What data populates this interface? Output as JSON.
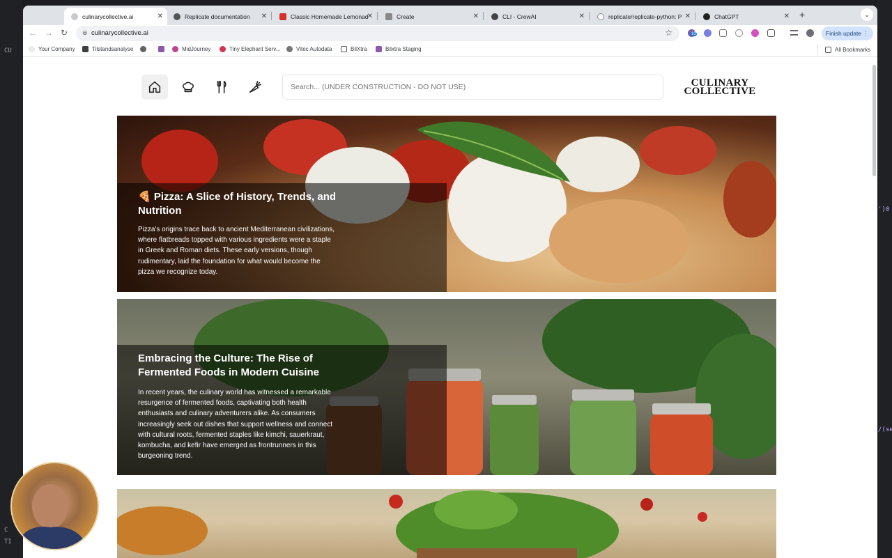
{
  "browser": {
    "tabs": [
      {
        "title": "culinarycollective.ai",
        "active": true
      },
      {
        "title": "Replicate documentation",
        "active": false
      },
      {
        "title": "Classic Homemade Lemonad",
        "active": false
      },
      {
        "title": "Create",
        "active": false
      },
      {
        "title": "CLI - CrewAI",
        "active": false
      },
      {
        "title": "replicate/replicate-python: P",
        "active": false
      },
      {
        "title": "ChatGPT",
        "active": false
      }
    ],
    "new_tab_symbol": "+",
    "url": "culinarycollective.ai",
    "finish_update_label": "Finish update",
    "extension_badge": "10",
    "bookmarks": [
      {
        "label": "Your Company",
        "icon": "globe-icon"
      },
      {
        "label": "Tilstandsanalyse",
        "icon": "page-icon"
      },
      {
        "label": "",
        "icon": "globe-icon"
      },
      {
        "label": "",
        "icon": "flag-icon"
      },
      {
        "label": "MidJourney",
        "icon": "midjourney-icon"
      },
      {
        "label": "Tiny Elephant Serv...",
        "icon": "elephant-icon"
      },
      {
        "label": "Vitec Autodata",
        "icon": "vitec-icon"
      },
      {
        "label": "BilXtra",
        "icon": "folder-icon"
      },
      {
        "label": "Bilxtra Staging",
        "icon": "flag-icon"
      }
    ],
    "all_bookmarks_label": "All Bookmarks"
  },
  "site": {
    "logo_line1": "CULINARY",
    "logo_line2": "COLLECTIVE",
    "search_placeholder": "Search... (UNDER CONSTRUCTION - DO NOT USE)",
    "nav": [
      "home-icon",
      "chef-hat-icon",
      "cutlery-icon",
      "carrot-icon"
    ]
  },
  "articles": [
    {
      "emoji": "🍕",
      "title": "Pizza: A Slice of History, Trends, and Nutrition",
      "excerpt": "Pizza's origins trace back to ancient Mediterranean civilizations, where flatbreads topped with various ingredients were a staple in Greek and Roman diets. These early versions, though rudimentary, laid the foundation for what would become the pizza we recognize today."
    },
    {
      "emoji": "",
      "title": "Embracing the Culture: The Rise of Fermented Foods in Modern Cuisine",
      "excerpt": "In recent years, the culinary world has witnessed a remarkable resurgence of fermented foods, captivating both health enthusiasts and culinary adventurers alike. As consumers increasingly seek out dishes that support wellness and connect with cultural roots, fermented staples like kimchi, sauerkraut, kombucha, and kefir have emerged as frontrunners in this burgeoning trend."
    },
    {
      "emoji": "",
      "title": "",
      "excerpt": ""
    }
  ],
  "background_editor": {
    "left_marks": [
      "CU",
      "C",
      "TI"
    ],
    "right_code": [
      "')0",
      "/(se"
    ]
  }
}
